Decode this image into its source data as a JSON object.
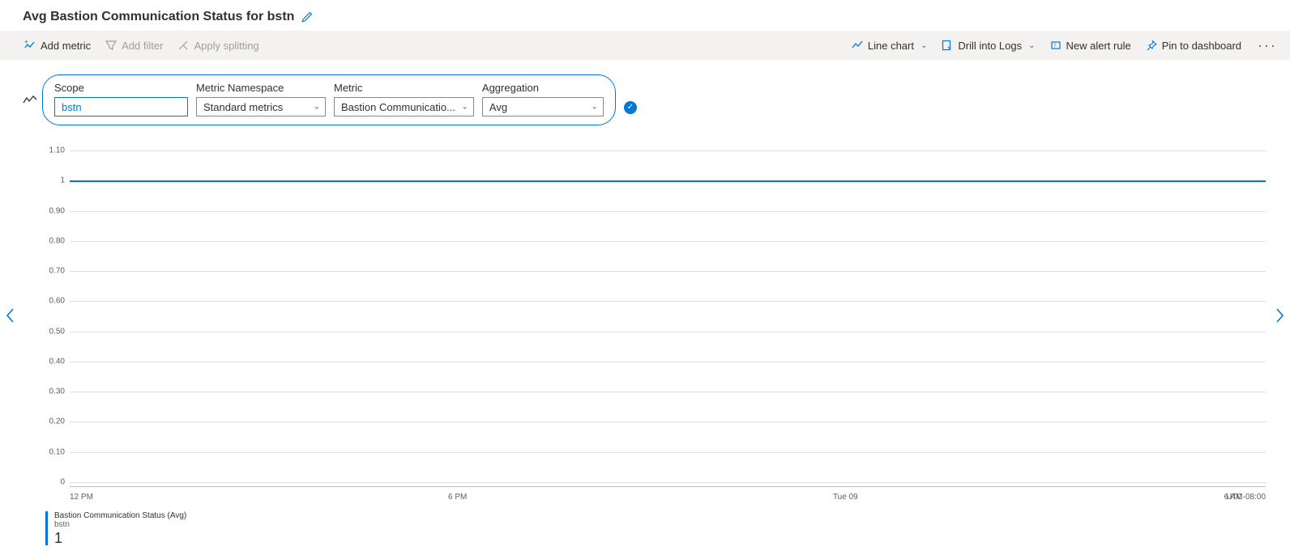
{
  "title": "Avg Bastion Communication Status for bstn",
  "toolbar": {
    "add_metric": "Add metric",
    "add_filter": "Add filter",
    "apply_splitting": "Apply splitting",
    "line_chart": "Line chart",
    "drill_logs": "Drill into Logs",
    "new_alert": "New alert rule",
    "pin": "Pin to dashboard"
  },
  "picker": {
    "scope_label": "Scope",
    "scope_value": "bstn",
    "namespace_label": "Metric Namespace",
    "namespace_value": "Standard metrics",
    "metric_label": "Metric",
    "metric_value": "Bastion Communicatio...",
    "aggregation_label": "Aggregation",
    "aggregation_value": "Avg"
  },
  "legend": {
    "series": "Bastion Communication Status (Avg)",
    "resource": "bstn",
    "value": "1"
  },
  "tz": "UTC-08:00",
  "chart_data": {
    "type": "line",
    "title": "Avg Bastion Communication Status for bstn",
    "xlabel": "",
    "ylabel": "",
    "ylim": [
      0,
      1.1
    ],
    "y_ticks": [
      "1.10",
      "1",
      "0.90",
      "0.80",
      "0.70",
      "0.60",
      "0.50",
      "0.40",
      "0.30",
      "0.20",
      "0.10",
      "0"
    ],
    "x_ticks": [
      "12 PM",
      "6 PM",
      "Tue 09",
      "6 AM"
    ],
    "series": [
      {
        "name": "Bastion Communication Status (Avg)",
        "color": "#0078d4",
        "x": [
          "12 PM",
          "6 PM",
          "Tue 09",
          "6 AM"
        ],
        "values": [
          1,
          1,
          1,
          1
        ]
      }
    ]
  }
}
